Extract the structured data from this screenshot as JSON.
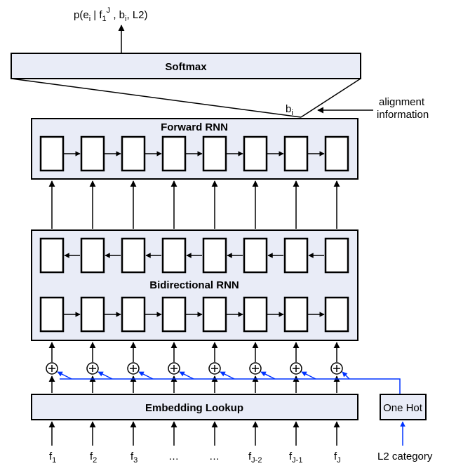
{
  "output_label": {
    "p": "p(e",
    "ei_sub": "i",
    "mid": " | f",
    "f_sub": "1",
    "f_sup": "J",
    "tail": " , b",
    "bi_sub": "i",
    "end": ", L2)"
  },
  "softmax": "Softmax",
  "forward_rnn": "Forward RNN",
  "bidi_rnn": "Bidirectional RNN",
  "embedding": "Embedding Lookup",
  "one_hot": "One Hot",
  "alignment1": "alignment",
  "alignment2": "information",
  "bi": {
    "b": "b",
    "sub": "i"
  },
  "inputs": {
    "f1": {
      "base": "f",
      "sub": "1"
    },
    "f2": {
      "base": "f",
      "sub": "2"
    },
    "f3": {
      "base": "f",
      "sub": "3"
    },
    "dots1": "…",
    "dots2": "…",
    "fJm2": {
      "base": "f",
      "sub": "J-2"
    },
    "fJm1": {
      "base": "f",
      "sub": "J-1"
    },
    "fJ": {
      "base": "f",
      "sub": "J"
    },
    "l2": "L2 category"
  }
}
